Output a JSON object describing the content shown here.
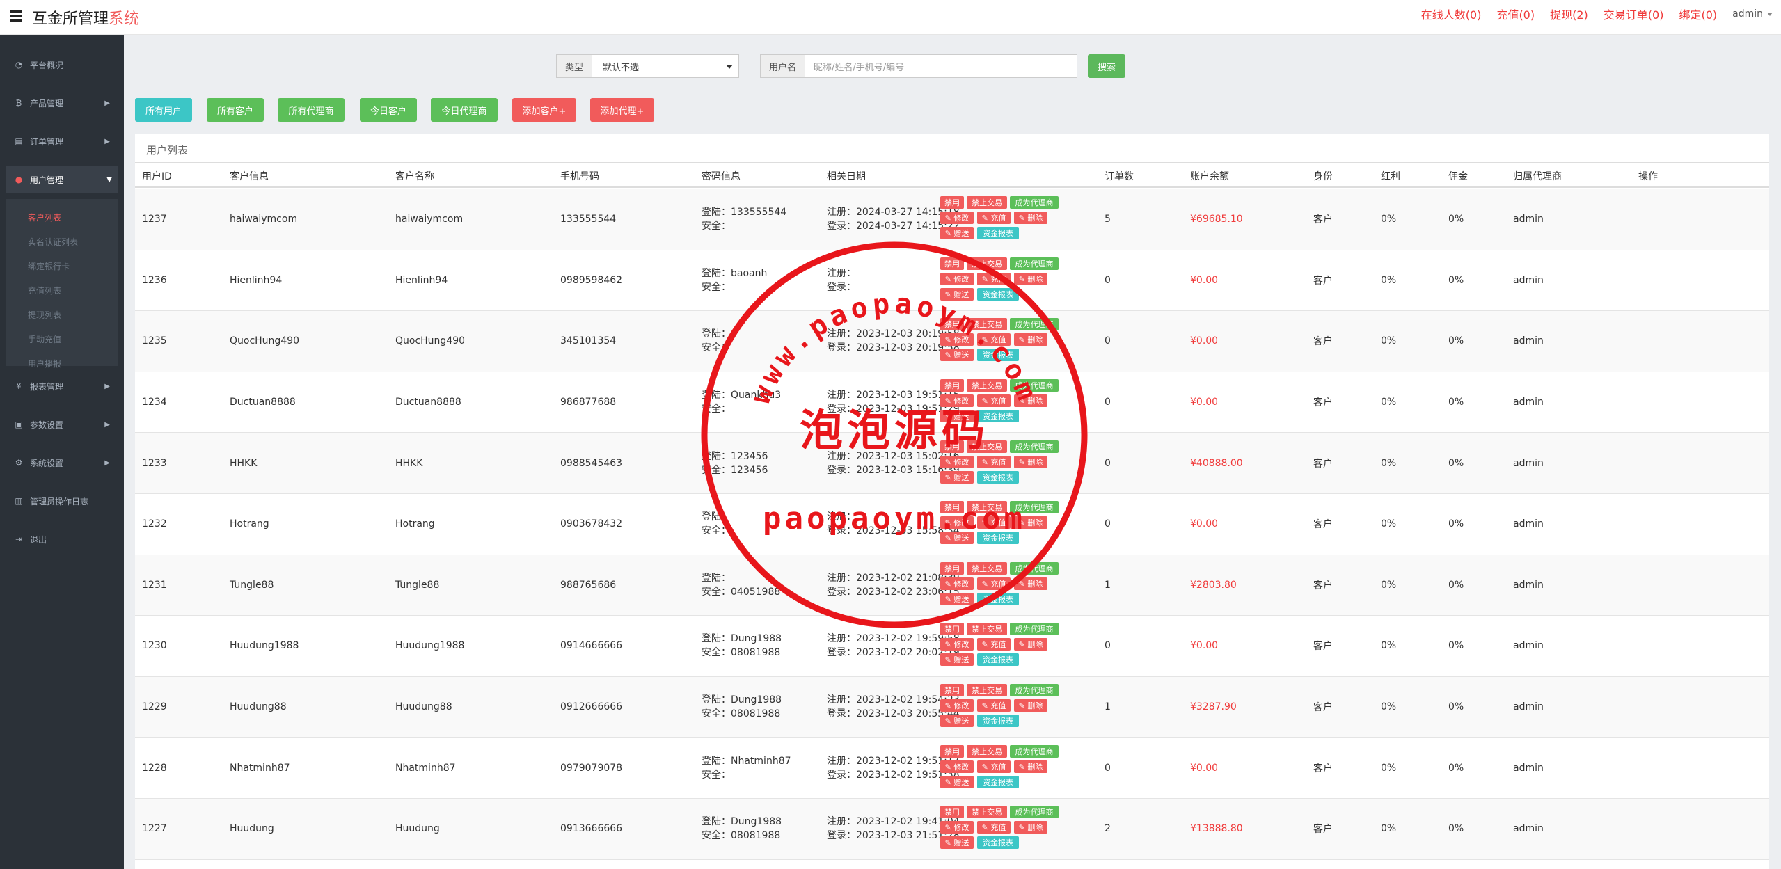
{
  "header": {
    "brand_main": "互金所管理",
    "brand_accent": "系统",
    "nav": [
      "在线人数(0)",
      "充值(0)",
      "提现(2)",
      "交易订单(0)",
      "绑定(0)"
    ],
    "user": "admin"
  },
  "sidebar": {
    "items": [
      {
        "label": "平台概况",
        "icon": "dashboard-icon"
      },
      {
        "label": "产品管理",
        "icon": "bitcoin-icon"
      },
      {
        "label": "订单管理",
        "icon": "order-icon"
      },
      {
        "label": "用户管理",
        "icon": "user-icon"
      },
      {
        "label": "报表管理",
        "icon": "yen-icon"
      },
      {
        "label": "参数设置",
        "icon": "settings-icon"
      },
      {
        "label": "系统设置",
        "icon": "gears-icon"
      },
      {
        "label": "管理员操作日志",
        "icon": "log-icon"
      },
      {
        "label": "退出",
        "icon": "logout-icon"
      }
    ],
    "sub_items": [
      "客户列表",
      "实名认证列表",
      "绑定银行卡",
      "充值列表",
      "提现列表",
      "手动充值",
      "用户播报"
    ]
  },
  "filters": {
    "type_label": "类型",
    "type_value": "默认不选",
    "user_label": "用户名",
    "user_placeholder": "昵称/姓名/手机号/编号",
    "search_button": "搜索"
  },
  "actions": [
    "所有用户",
    "所有客户",
    "所有代理商",
    "今日客户",
    "今日代理商",
    "添加客户+",
    "添加代理+"
  ],
  "panel_title": "用户列表",
  "columns": [
    "用户ID",
    "客户信息",
    "客户名称",
    "手机号码",
    "密码信息",
    "相关日期",
    "订单数",
    "账户余额",
    "身份",
    "红利",
    "佣金",
    "归属代理商",
    "操作"
  ],
  "labels": {
    "login": "登陆：",
    "safe": "安全：",
    "reg": "注册：",
    "last": "登录："
  },
  "op_buttons": {
    "ban": "禁用",
    "stop_trade": "禁止交易",
    "to_agent": "成为代理商",
    "edit": "✎ 修改",
    "recharge": "✎ 充值",
    "delete": "✎ 删除",
    "gift": "✎ 赠送",
    "fund_report": "资金报表"
  },
  "rows": [
    {
      "id": "1237",
      "info": "haiwaiymcom",
      "name": "haiwaiymcom",
      "phone": "133555544",
      "pw_login": "133555544",
      "pw_safe": "",
      "reg": "2024-03-27 14:15:18",
      "last": "2024-03-27 14:15:22",
      "orders": "5",
      "balance": "¥69685.10",
      "role": "客户",
      "bonus": "0%",
      "commission": "0%",
      "agent": "admin"
    },
    {
      "id": "1236",
      "info": "Hienlinh94",
      "name": "Hienlinh94",
      "phone": "0989598462",
      "pw_login": "baoanh",
      "pw_safe": "",
      "reg": "",
      "last": "",
      "orders": "0",
      "balance": "¥0.00",
      "role": "客户",
      "bonus": "0%",
      "commission": "0%",
      "agent": "admin"
    },
    {
      "id": "1235",
      "info": "QuocHung490",
      "name": "QuocHung490",
      "phone": "345101354",
      "pw_login": "",
      "pw_safe": "",
      "reg": "2023-12-03 20:19:58",
      "last": "2023-12-03 20:19:58",
      "orders": "0",
      "balance": "¥0.00",
      "role": "客户",
      "bonus": "0%",
      "commission": "0%",
      "agent": "admin"
    },
    {
      "id": "1234",
      "info": "Ductuan8888",
      "name": "Ductuan8888",
      "phone": "986877688",
      "pw_login": "Quankhu3",
      "pw_safe": "",
      "reg": "2023-12-03 19:51:15",
      "last": "2023-12-03 19:51:29",
      "orders": "0",
      "balance": "¥0.00",
      "role": "客户",
      "bonus": "0%",
      "commission": "0%",
      "agent": "admin"
    },
    {
      "id": "1233",
      "info": "HHKK",
      "name": "HHKK",
      "phone": "0988545463",
      "pw_login": "123456",
      "pw_safe": "123456",
      "reg": "2023-12-03 15:02:16",
      "last": "2023-12-03 15:16:39",
      "orders": "0",
      "balance": "¥40888.00",
      "role": "客户",
      "bonus": "0%",
      "commission": "0%",
      "agent": "admin"
    },
    {
      "id": "1232",
      "info": "Hotrang",
      "name": "Hotrang",
      "phone": "0903678432",
      "pw_login": "",
      "pw_safe": "",
      "reg": "",
      "last": "2023-12-03 15:58:34",
      "orders": "0",
      "balance": "¥0.00",
      "role": "客户",
      "bonus": "0%",
      "commission": "0%",
      "agent": "admin"
    },
    {
      "id": "1231",
      "info": "Tungle88",
      "name": "Tungle88",
      "phone": "988765686",
      "pw_login": "",
      "pw_safe": "04051988",
      "reg": "2023-12-02 21:08:39",
      "last": "2023-12-02 23:06:15",
      "orders": "1",
      "balance": "¥2803.80",
      "role": "客户",
      "bonus": "0%",
      "commission": "0%",
      "agent": "admin"
    },
    {
      "id": "1230",
      "info": "Huudung1988",
      "name": "Huudung1988",
      "phone": "0914666666",
      "pw_login": "Dung1988",
      "pw_safe": "08081988",
      "reg": "2023-12-02 19:59:58",
      "last": "2023-12-02 20:02:19",
      "orders": "0",
      "balance": "¥0.00",
      "role": "客户",
      "bonus": "0%",
      "commission": "0%",
      "agent": "admin"
    },
    {
      "id": "1229",
      "info": "Huudung88",
      "name": "Huudung88",
      "phone": "0912666666",
      "pw_login": "Dung1988",
      "pw_safe": "08081988",
      "reg": "2023-12-02 19:54:23",
      "last": "2023-12-03 20:55:44",
      "orders": "1",
      "balance": "¥3287.90",
      "role": "客户",
      "bonus": "0%",
      "commission": "0%",
      "agent": "admin"
    },
    {
      "id": "1228",
      "info": "Nhatminh87",
      "name": "Nhatminh87",
      "phone": "0979079078",
      "pw_login": "Nhatminh87",
      "pw_safe": "",
      "reg": "2023-12-02 19:51:17",
      "last": "2023-12-02 19:51:38",
      "orders": "0",
      "balance": "¥0.00",
      "role": "客户",
      "bonus": "0%",
      "commission": "0%",
      "agent": "admin"
    },
    {
      "id": "1227",
      "info": "Huudung",
      "name": "Huudung",
      "phone": "0913666666",
      "pw_login": "Dung1988",
      "pw_safe": "08081988",
      "reg": "2023-12-02 19:41:04",
      "last": "2023-12-03 21:51:28",
      "orders": "2",
      "balance": "¥13888.80",
      "role": "客户",
      "bonus": "0%",
      "commission": "0%",
      "agent": "admin"
    }
  ],
  "watermark": {
    "url_arc": "www.paopaoym.com",
    "center_cn": "泡泡源码",
    "bottom": "paopaoym.com",
    "color": "#e8161b"
  },
  "colors": {
    "cyan": "#3cc6c6",
    "green": "#5cbf59",
    "red": "#f15b5b",
    "money": "#f03a3a",
    "sidebar": "#2b3138"
  }
}
